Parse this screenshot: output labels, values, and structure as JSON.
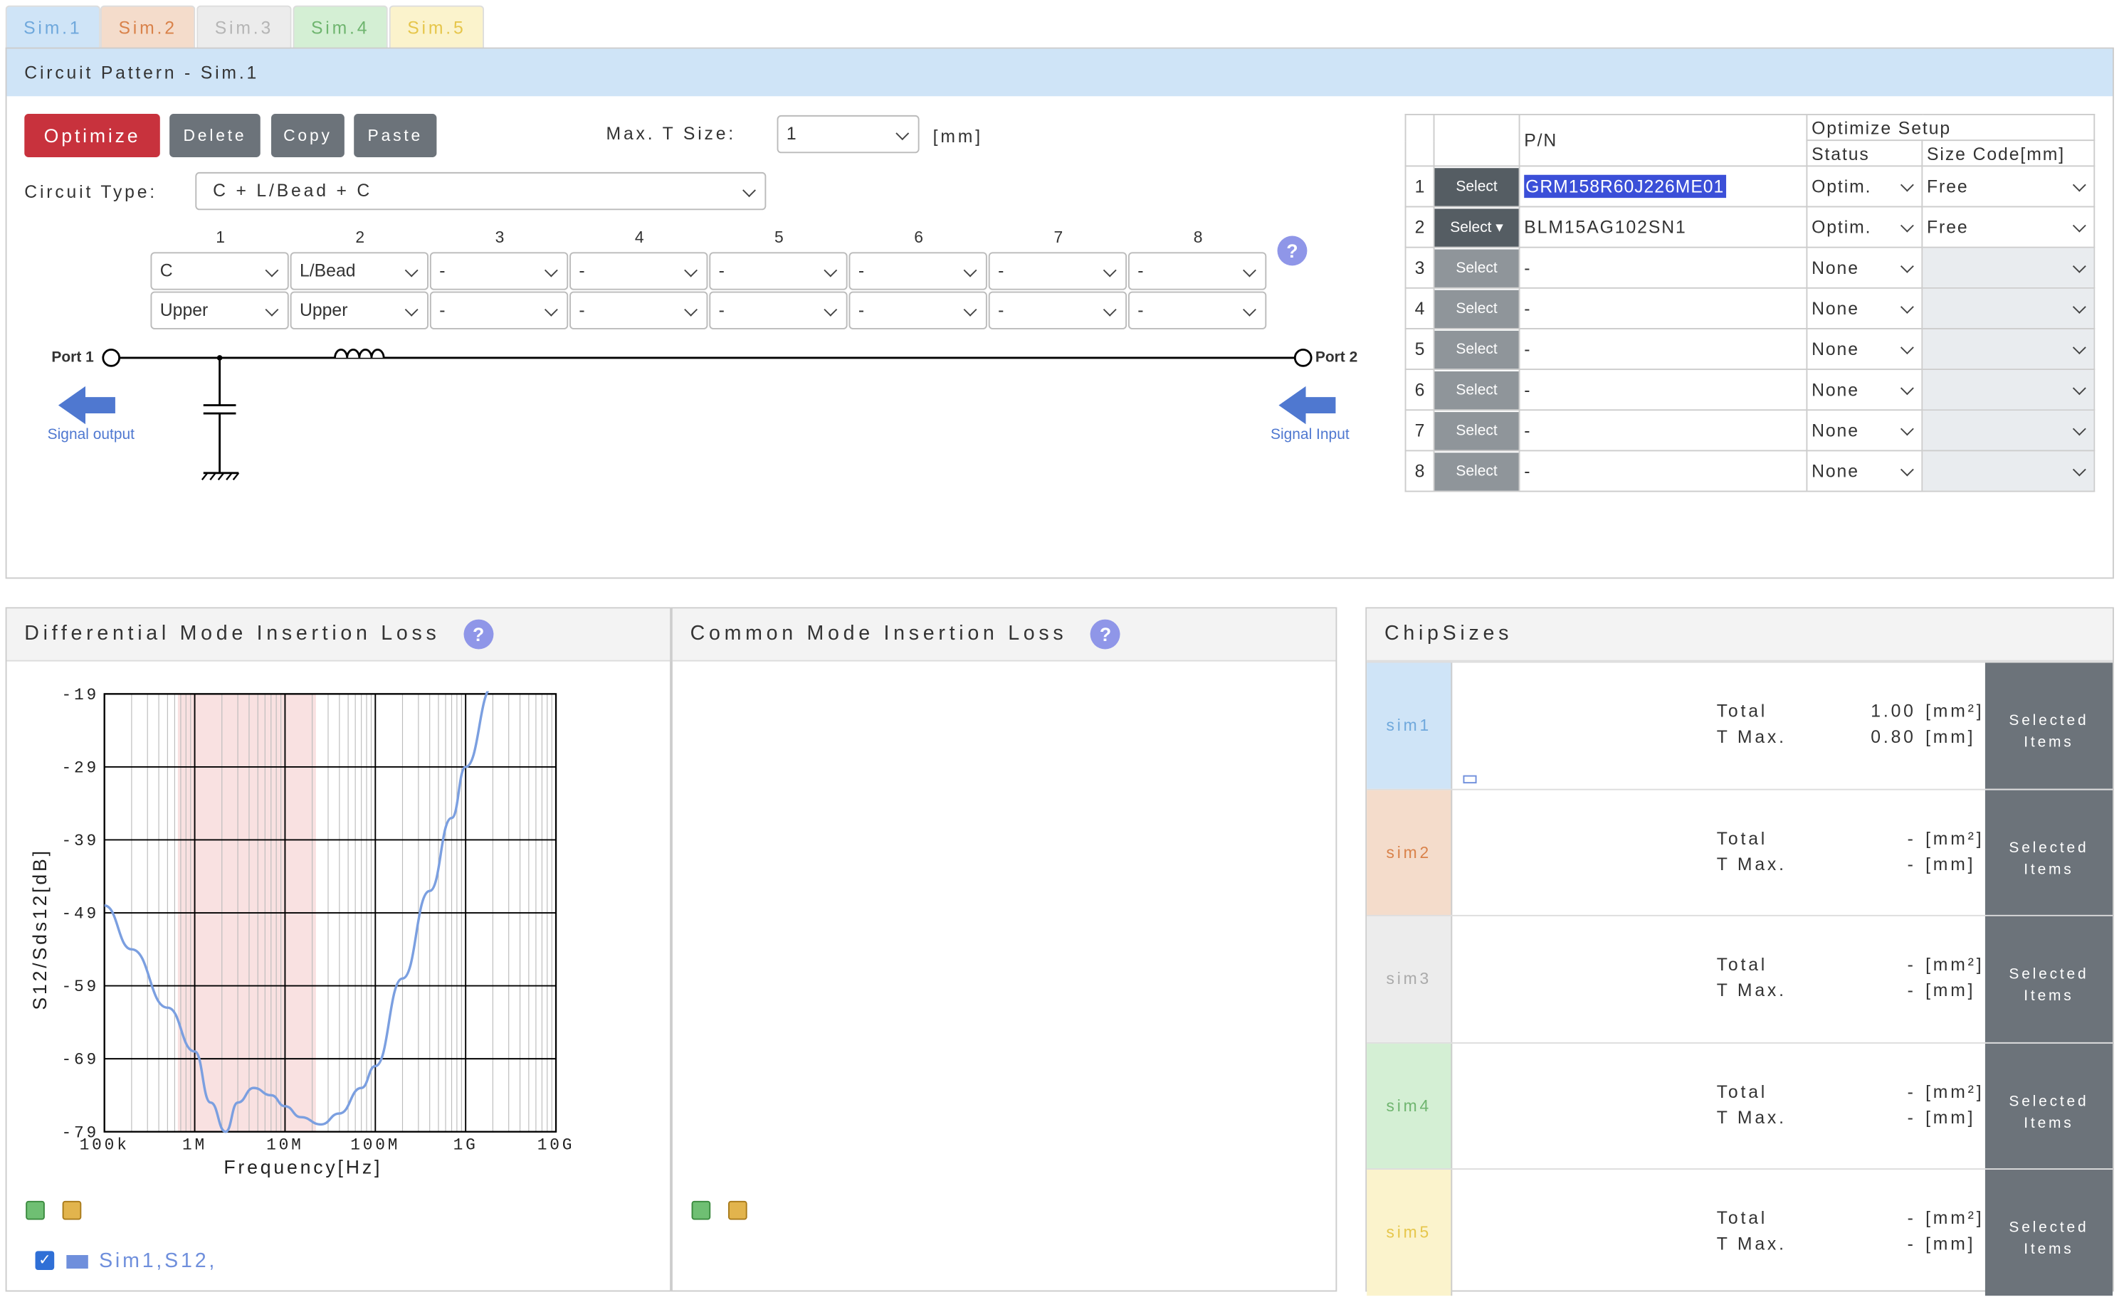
{
  "tabs": [
    {
      "label": "Sim.1",
      "color": "#6fa8dc",
      "bg": "#cfe4f7"
    },
    {
      "label": "Sim.2",
      "color": "#d9824a",
      "bg": "#f4dccb"
    },
    {
      "label": "Sim.3",
      "color": "#b5b5b5",
      "bg": "#ececec"
    },
    {
      "label": "Sim.4",
      "color": "#6fb56f",
      "bg": "#d4efd4"
    },
    {
      "label": "Sim.5",
      "color": "#e6c64b",
      "bg": "#fbf3cc"
    }
  ],
  "circuit": {
    "header": "Circuit Pattern - Sim.1",
    "buttons": {
      "optimize": "Optimize",
      "delete": "Delete",
      "copy": "Copy",
      "paste": "Paste"
    },
    "max_t_label": "Max. T Size:",
    "max_t_value": "1",
    "max_t_unit": "[mm]",
    "type_label": "Circuit Type:",
    "type_value": "C + L/Bead + C",
    "columns": [
      "1",
      "2",
      "3",
      "4",
      "5",
      "6",
      "7",
      "8"
    ],
    "components": [
      "C",
      "L/Bead",
      "-",
      "-",
      "-",
      "-",
      "-",
      "-"
    ],
    "positions": [
      "Upper",
      "Upper",
      "-",
      "-",
      "-",
      "-",
      "-",
      "-"
    ],
    "port1": "Port 1",
    "port2": "Port 2",
    "signal_output": "Signal output",
    "signal_input": "Signal Input"
  },
  "parts": {
    "pn_header": "P/N",
    "setup_header": "Optimize Setup",
    "status_header": "Status",
    "size_header": "Size Code[mm]",
    "rows": [
      {
        "n": "1",
        "select": "Select",
        "pn": "GRM158R60J226ME01",
        "status": "Optim.",
        "size": "Free"
      },
      {
        "n": "2",
        "select": "Select ▾",
        "pn": "BLM15AG102SN1",
        "status": "Optim.",
        "size": "Free"
      },
      {
        "n": "3",
        "select": "Select",
        "pn": "-",
        "status": "None",
        "size": ""
      },
      {
        "n": "4",
        "select": "Select",
        "pn": "-",
        "status": "None",
        "size": ""
      },
      {
        "n": "5",
        "select": "Select",
        "pn": "-",
        "status": "None",
        "size": ""
      },
      {
        "n": "6",
        "select": "Select",
        "pn": "-",
        "status": "None",
        "size": ""
      },
      {
        "n": "7",
        "select": "Select",
        "pn": "-",
        "status": "None",
        "size": ""
      },
      {
        "n": "8",
        "select": "Select",
        "pn": "-",
        "status": "None",
        "size": ""
      }
    ]
  },
  "dm_title": "Differential Mode Insertion Loss",
  "cm_title": "Common Mode Insertion Loss",
  "legend": {
    "label": "Sim1,S12,",
    "color": "#6f8fdc"
  },
  "chart_data": {
    "type": "line",
    "xlabel": "Frequency[Hz]",
    "ylabel": "S12/Sds12[dB]",
    "x_scale": "log",
    "xlim": [
      100000,
      10000000000
    ],
    "ylim": [
      -79,
      -19
    ],
    "x_ticks": [
      "100k",
      "1M",
      "10M",
      "100M",
      "1G",
      "10G"
    ],
    "y_ticks": [
      "-19",
      "-29",
      "-39",
      "-49",
      "-59",
      "-69",
      "-79"
    ],
    "highlight_band": [
      650000,
      22000000
    ],
    "grid": true,
    "series": [
      {
        "name": "Sim1,S12,",
        "color": "#7b9fe0",
        "x": [
          100000,
          200000,
          500000,
          1000000,
          1500000,
          2200000,
          3000000,
          4500000,
          7000000,
          10000000,
          15000000,
          25000000,
          40000000,
          70000000,
          100000000,
          200000000,
          400000000,
          700000000,
          1000000000,
          2000000000,
          3300000000
        ],
        "y": [
          -48,
          -54,
          -62,
          -68,
          -75,
          -79,
          -75,
          -73,
          -74,
          -75.5,
          -77,
          -78,
          -76.5,
          -73,
          -70,
          -58,
          -46,
          -36,
          -29,
          -18,
          -13
        ]
      }
    ]
  },
  "chip": {
    "title": "ChipSizes",
    "total_label": "Total",
    "tmax_label": "T Max.",
    "area_unit": "[mm²]",
    "len_unit": "[mm]",
    "selected_label": "Selected Items",
    "rows": [
      {
        "name": "sim1",
        "total": "1.00",
        "tmax": "0.80",
        "color": "#6fa8dc",
        "bg": "#cfe4f7"
      },
      {
        "name": "sim2",
        "total": "-",
        "tmax": "-",
        "color": "#d9824a",
        "bg": "#f4dccb"
      },
      {
        "name": "sim3",
        "total": "-",
        "tmax": "-",
        "color": "#aaaaaa",
        "bg": "#ececec"
      },
      {
        "name": "sim4",
        "total": "-",
        "tmax": "-",
        "color": "#6fb56f",
        "bg": "#d4efd4"
      },
      {
        "name": "sim5",
        "total": "-",
        "tmax": "-",
        "color": "#e6c64b",
        "bg": "#fbf3cc"
      }
    ]
  }
}
